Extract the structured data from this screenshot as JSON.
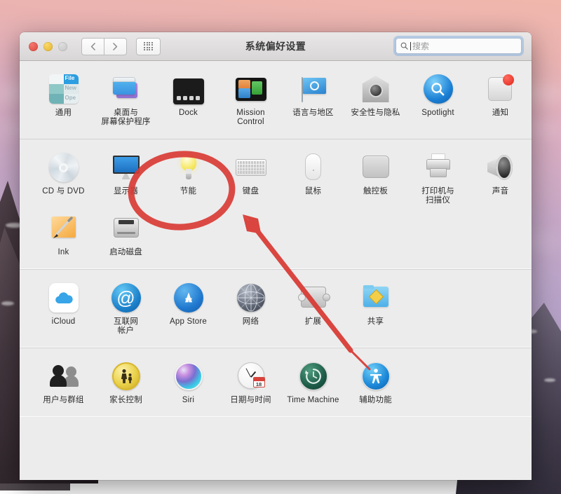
{
  "window": {
    "title": "系统偏好设置",
    "traffic_lights": [
      "close-red",
      "minimize-yellow",
      "zoom-gray-disabled"
    ],
    "nav": {
      "back": "‹",
      "forward": "›",
      "grid": "grid-icon"
    },
    "search": {
      "placeholder": "搜索",
      "value": "",
      "icon": "search-icon",
      "focused": true
    }
  },
  "sections": [
    {
      "name": "personal",
      "items": [
        {
          "label": "通用",
          "icon": "general-icon"
        },
        {
          "label": "桌面与\n屏幕保护程序",
          "icon": "desktop-screensaver-icon"
        },
        {
          "label": "Dock",
          "icon": "dock-icon"
        },
        {
          "label": "Mission\nControl",
          "icon": "mission-control-icon"
        },
        {
          "label": "语言与地区",
          "icon": "language-region-icon"
        },
        {
          "label": "安全性与隐私",
          "icon": "security-privacy-icon"
        },
        {
          "label": "Spotlight",
          "icon": "spotlight-icon"
        },
        {
          "label": "通知",
          "icon": "notifications-icon",
          "badge": true
        }
      ]
    },
    {
      "name": "hardware",
      "items": [
        {
          "label": "CD 与 DVD",
          "icon": "cd-dvd-icon"
        },
        {
          "label": "显示器",
          "icon": "displays-icon"
        },
        {
          "label": "节能",
          "icon": "energy-saver-icon",
          "highlighted": true
        },
        {
          "label": "键盘",
          "icon": "keyboard-icon"
        },
        {
          "label": "鼠标",
          "icon": "mouse-icon"
        },
        {
          "label": "触控板",
          "icon": "trackpad-icon"
        },
        {
          "label": "打印机与\n扫描仪",
          "icon": "printers-scanners-icon"
        },
        {
          "label": "声音",
          "icon": "sound-icon"
        },
        {
          "label": "Ink",
          "icon": "ink-icon"
        },
        {
          "label": "启动磁盘",
          "icon": "startup-disk-icon"
        }
      ]
    },
    {
      "name": "internet-wireless",
      "items": [
        {
          "label": "iCloud",
          "icon": "icloud-icon"
        },
        {
          "label": "互联网\n帐户",
          "icon": "internet-accounts-icon"
        },
        {
          "label": "App Store",
          "icon": "app-store-icon"
        },
        {
          "label": "网络",
          "icon": "network-icon"
        },
        {
          "label": "扩展",
          "icon": "extensions-icon"
        },
        {
          "label": "共享",
          "icon": "sharing-icon"
        }
      ]
    },
    {
      "name": "system",
      "items": [
        {
          "label": "用户与群组",
          "icon": "users-groups-icon"
        },
        {
          "label": "家长控制",
          "icon": "parental-controls-icon"
        },
        {
          "label": "Siri",
          "icon": "siri-icon"
        },
        {
          "label": "日期与时间",
          "icon": "date-time-icon",
          "badge_number": "18"
        },
        {
          "label": "Time Machine",
          "icon": "time-machine-icon"
        },
        {
          "label": "辅助功能",
          "icon": "accessibility-icon"
        }
      ]
    }
  ],
  "annotation": {
    "ellipse": {
      "target": "节能",
      "color": "#d93b35"
    },
    "arrow": {
      "points_to": "节能",
      "color": "#d93b35"
    }
  },
  "colors": {
    "accent_red": "#d93b35",
    "window_bg": "#ececec",
    "titlebar_top": "#e9e7e7",
    "titlebar_bottom": "#d8d6d6",
    "label_text": "#2b2b2b",
    "focus_ring": "#68a0e1"
  }
}
